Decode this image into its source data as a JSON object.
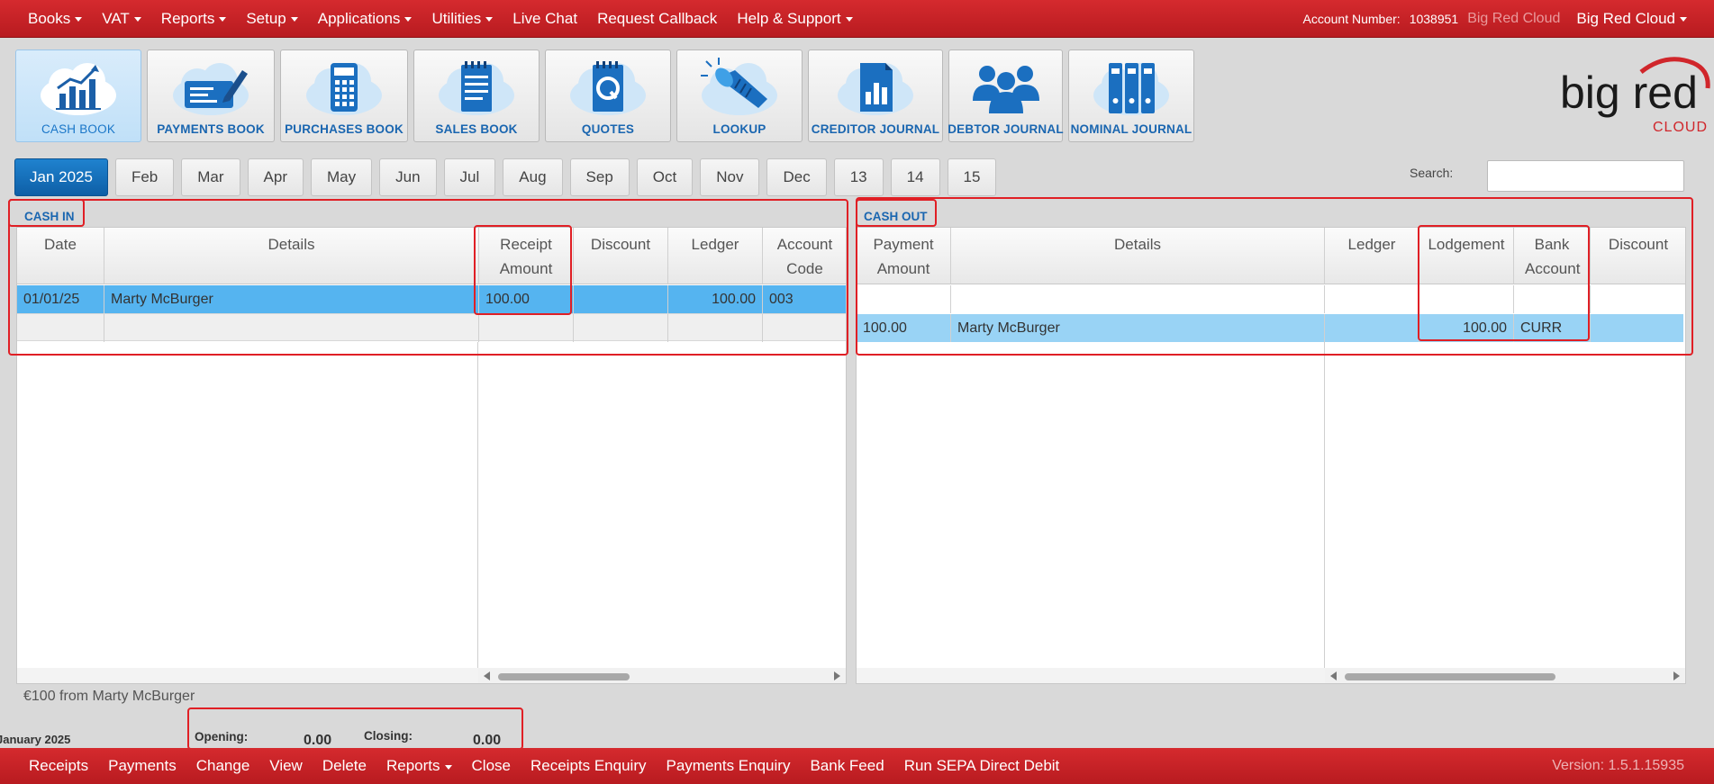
{
  "topnav": {
    "items": [
      {
        "label": "Books",
        "dropdown": true
      },
      {
        "label": "VAT",
        "dropdown": true
      },
      {
        "label": "Reports",
        "dropdown": true
      },
      {
        "label": "Setup",
        "dropdown": true
      },
      {
        "label": "Applications",
        "dropdown": true
      },
      {
        "label": "Utilities",
        "dropdown": true
      },
      {
        "label": "Live Chat",
        "dropdown": false
      },
      {
        "label": "Request Callback",
        "dropdown": false
      },
      {
        "label": "Help & Support",
        "dropdown": true
      }
    ],
    "account_label": "Account Number:",
    "account_number": "1038951",
    "company_dim": "Big Red Cloud",
    "company": "Big Red Cloud"
  },
  "toolbar": {
    "cash_book": "CASH BOOK",
    "payments_book": "PAYMENTS BOOK",
    "purchases_book": "PURCHASES BOOK",
    "sales_book": "SALES BOOK",
    "quotes": "QUOTES",
    "lookup": "LOOKUP",
    "creditor_journal": "CREDITOR JOURNAL",
    "debtor_journal": "DEBTOR JOURNAL",
    "nominal_journal": "NOMINAL JOURNAL"
  },
  "logo": {
    "line1": "big red",
    "line2": "CLOUD"
  },
  "months": [
    "Jan 2025",
    "Feb",
    "Mar",
    "Apr",
    "May",
    "Jun",
    "Jul",
    "Aug",
    "Sep",
    "Oct",
    "Nov",
    "Dec",
    "13",
    "14",
    "15"
  ],
  "search": {
    "label": "Search:",
    "value": ""
  },
  "cash_in": {
    "label": "CASH IN",
    "headers": {
      "date": "Date",
      "details": "Details",
      "receipt_amount": "Receipt Amount",
      "discount": "Discount",
      "ledger": "Ledger",
      "account_code": "Account Code"
    },
    "rows": [
      {
        "date": "01/01/25",
        "details": "Marty McBurger",
        "receipt_amount": "100.00",
        "discount": "",
        "ledger": "100.00",
        "account_code": "003"
      }
    ]
  },
  "cash_out": {
    "label": "CASH OUT",
    "headers": {
      "payment_amount": "Payment Amount",
      "details": "Details",
      "ledger": "Ledger",
      "lodgement": "Lodgement",
      "bank_account": "Bank Account",
      "discount": "Discount"
    },
    "rows": [
      {
        "payment_amount": "100.00",
        "details": "Marty McBurger",
        "ledger": "",
        "lodgement": "100.00",
        "bank_account": "CURR",
        "discount": ""
      }
    ]
  },
  "note": "€100 from Marty McBurger",
  "period": "January 2025",
  "totals": {
    "opening_label": "Opening:",
    "opening_value": "0.00",
    "closing_label": "Closing:",
    "closing_value": "0.00"
  },
  "bottombar": {
    "items": [
      {
        "label": "Receipts",
        "dropdown": false
      },
      {
        "label": "Payments",
        "dropdown": false
      },
      {
        "label": "Change",
        "dropdown": false
      },
      {
        "label": "View",
        "dropdown": false
      },
      {
        "label": "Delete",
        "dropdown": false
      },
      {
        "label": "Reports",
        "dropdown": true
      },
      {
        "label": "Close",
        "dropdown": false
      },
      {
        "label": "Receipts Enquiry",
        "dropdown": false
      },
      {
        "label": "Payments Enquiry",
        "dropdown": false
      },
      {
        "label": "Bank Feed",
        "dropdown": false
      },
      {
        "label": "Run SEPA Direct Debit",
        "dropdown": false
      }
    ],
    "version": "Version: 1.5.1.15935"
  },
  "colors": {
    "brand_red": "#c72126",
    "accent_blue": "#1a66b0",
    "row_selected": "#55b4f0",
    "row_selected_light": "#99d3f5",
    "annotation": "#e01f25"
  }
}
